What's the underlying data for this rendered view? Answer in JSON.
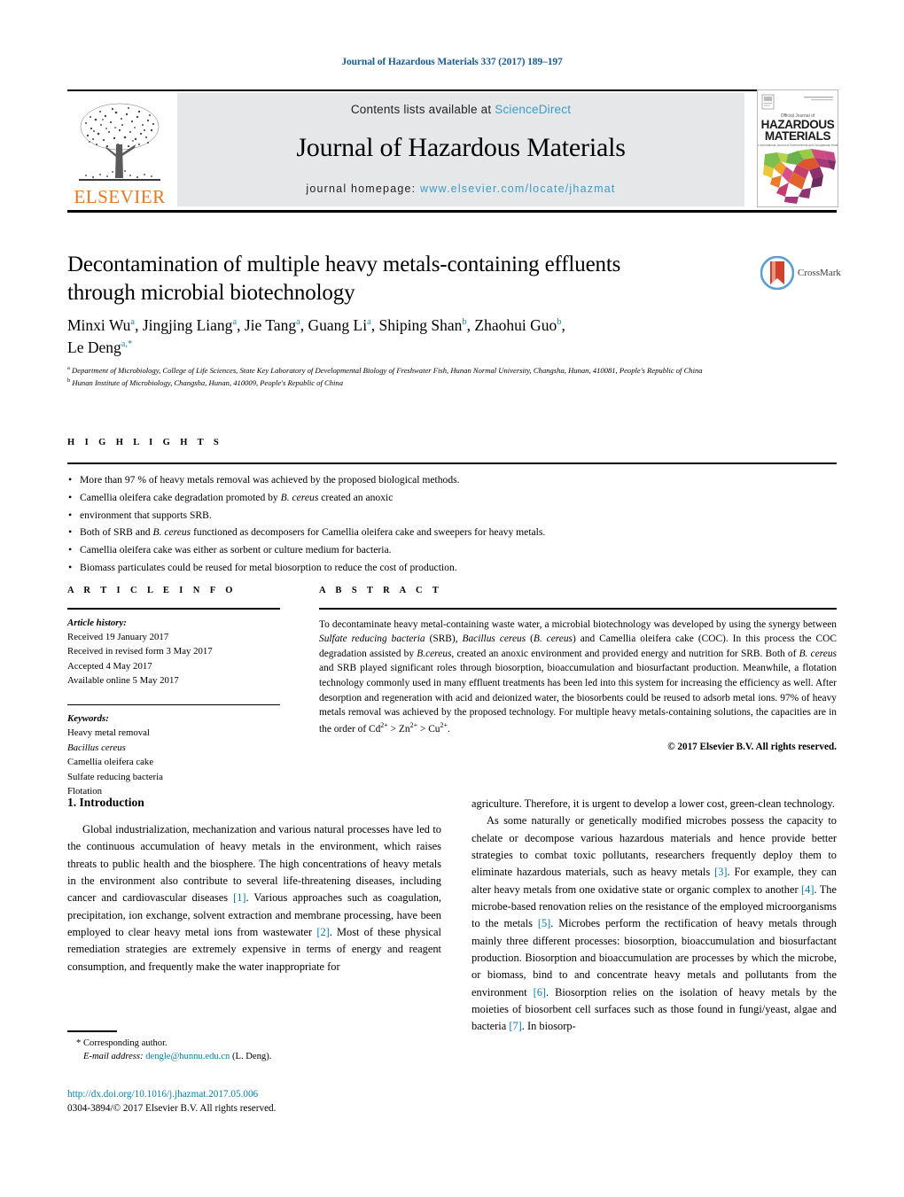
{
  "running_head": "Journal of Hazardous Materials 337 (2017) 189–197",
  "masthead": {
    "contents_prefix": "Contents lists available at ",
    "sciencedirect": "ScienceDirect",
    "journal_title": "Journal of Hazardous Materials",
    "homepage_prefix": "journal homepage: ",
    "homepage_url": "www.elsevier.com/locate/jhazmat",
    "publisher": "ELSEVIER",
    "cover_line1": "HAZARDOUS",
    "cover_line2": "MATERIALS",
    "cover_kicker": "Official Journal of",
    "cover_subtitle": "An International Journal of Environmental and Occupational Health",
    "cover_corner": "AVAILABLE ONLINE AT SCIENCEDIRECT",
    "accent_link": "#3a9cc9",
    "elsevier_orange": "#E87722",
    "panel_gray": "#e6e7e8"
  },
  "article": {
    "title": "Decontamination of multiple heavy metals-containing effluents through microbial biotechnology",
    "crossmark_label": "CrossMark",
    "authors_line1_parts": [
      {
        "name": "Minxi Wu",
        "sup": "a"
      },
      {
        "name": "Jingjing Liang",
        "sup": "a"
      },
      {
        "name": "Jie Tang",
        "sup": "a"
      },
      {
        "name": "Guang Li",
        "sup": "a"
      },
      {
        "name": "Shiping Shan",
        "sup": "b"
      },
      {
        "name": "Zhaohui Guo",
        "sup": "b"
      }
    ],
    "authors_last": {
      "name": "Le Deng",
      "sup": "a,*"
    },
    "affiliations": [
      {
        "marker": "a",
        "text": "Department of Microbiology, College of Life Sciences, State Key Laboratory of Developmental Biology of Freshwater Fish, Hunan Normal University, Changsha, Hunan, 410081, People's Republic of China"
      },
      {
        "marker": "b",
        "text": "Hunan Institute of Microbiology, Changsha, Hunan, 410009, People's Republic of China"
      }
    ]
  },
  "highlights": {
    "label": "H I G H L I G H T S",
    "items": [
      "More than 97 % of heavy metals removal was achieved by the proposed biological methods.",
      "Camellia oleifera cake degradation promoted by B. cereus created an anoxic",
      "environment that supports SRB.",
      "Both of SRB and B. cereus functioned as decomposers for Camellia oleifera cake and sweepers for heavy metals.",
      "Camellia oleifera cake was either as sorbent or culture medium for bacteria.",
      "Biomass particulates could be reused for metal biosorption to reduce the cost of production."
    ]
  },
  "article_info": {
    "label": "A R T I C L E   I N F O",
    "history_label": "Article history:",
    "history": [
      "Received 19 January 2017",
      "Received in revised form 3 May 2017",
      "Accepted 4 May 2017",
      "Available online 5 May 2017"
    ],
    "keywords_label": "Keywords:",
    "keywords": [
      "Heavy metal removal",
      "Bacillus cereus",
      "Camellia oleifera cake",
      "Sulfate reducing bacteria",
      "Flotation"
    ]
  },
  "abstract": {
    "label": "A B S T R A C T",
    "text": "To decontaminate heavy metal-containing waste water, a microbial biotechnology was developed by using the synergy between Sulfate reducing bacteria (SRB), Bacillus cereus (B. cereus) and Camellia oleifera cake (COC). In this process the COC degradation assisted by B.cereus, created an anoxic environment and provided energy and nutrition for SRB. Both of B. cereus and SRB played significant roles through biosorption, bioaccumulation and biosurfactant production. Meanwhile, a flotation technology commonly used in many effluent treatments has been led into this system for increasing the efficiency as well. After desorption and regeneration with acid and deionized water, the biosorbents could be reused to adsorb metal ions. 97% of heavy metals removal was achieved by the proposed technology. For multiple heavy metals-containing solutions, the capacities are in the order of Cd2+ > Zn2+ > Cu2+.",
    "copyright": "© 2017 Elsevier B.V. All rights reserved."
  },
  "introduction": {
    "heading": "1.  Introduction",
    "left_para1": "Global industrialization, mechanization and various natural processes have led to the continuous accumulation of heavy metals in the environment, which raises threats to public health and the biosphere. The high concentrations of heavy metals in the environment also contribute to several life-threatening diseases, including cancer and cardiovascular diseases [1]. Various approaches such as coagulation, precipitation, ion exchange, solvent extraction and membrane processing, have been employed to clear heavy metal ions from wastewater [2]. Most of these physical remediation strategies are extremely expensive in terms of energy and reagent consumption, and frequently make the water inappropriate for",
    "right_para1_cont": "agriculture. Therefore, it is urgent to develop a lower cost, green-clean technology.",
    "right_para2": "As some naturally or genetically modified microbes possess the capacity to chelate or decompose various hazardous materials and hence provide better strategies to combat toxic pollutants, researchers frequently deploy them to eliminate hazardous materials, such as heavy metals [3]. For example, they can alter heavy metals from one oxidative state or organic complex to another [4]. The microbe-based renovation relies on the resistance of the employed microorganisms to the metals [5]. Microbes perform the rectification of heavy metals through mainly three different processes: biosorption, bioaccumulation and biosurfactant production. Biosorption and bioaccumulation are processes by which the microbe, or biomass, bind to and concentrate heavy metals and pollutants from the environment [6]. Biosorption relies on the isolation of heavy metals by the moieties of biosorbent cell surfaces such as those found in fungi/yeast, algae and bacteria [7]. In biosorp-",
    "reference_marks": [
      "[1]",
      "[2]",
      "[3]",
      "[4]",
      "[5]",
      "[6]",
      "[7]"
    ]
  },
  "footer": {
    "corresponding_marker": "*",
    "corresponding_label": "Corresponding author.",
    "email_label": "E-mail address:",
    "email": "dengle@hunnu.edu.cn",
    "email_suffix": "(L. Deng).",
    "doi": "http://dx.doi.org/10.1016/j.jhazmat.2017.05.006",
    "issn_line": "0304-3894/© 2017 Elsevier B.V. All rights reserved."
  }
}
